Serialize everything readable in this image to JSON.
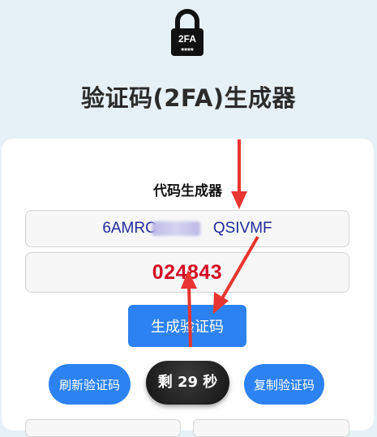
{
  "header": {
    "logo_text": "2FA",
    "logo_mask": "****",
    "title": "验证码(2FA)生成器"
  },
  "generator": {
    "section_title": "代码生成器",
    "secret_prefix": "6AMRC",
    "secret_suffix": "QSIVMF",
    "code": "024843",
    "generate_label": "生成验证码"
  },
  "actions": {
    "refresh_label": "刷新验证码",
    "timer_label": "剩 29 秒",
    "copy_label": "复制验证码"
  },
  "colors": {
    "background": "#e6f1f7",
    "primary": "#2d82f2",
    "code": "#d50b24",
    "secret": "#1f2a9a",
    "arrow": "#e8352f"
  },
  "icons": [
    "lock-icon"
  ]
}
